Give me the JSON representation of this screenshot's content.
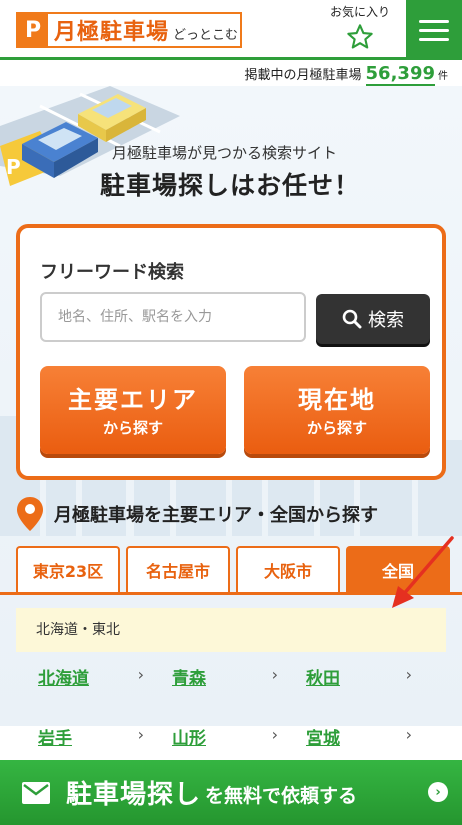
{
  "header": {
    "logo_mark": "P",
    "logo_main": "月極駐車場",
    "logo_sub": "どっとこむ",
    "favorites_label": "お気に入り"
  },
  "listing": {
    "label": "掲載中の月極駐車場",
    "count": "56,399",
    "unit": "件"
  },
  "hero": {
    "tagline": "月極駐車場が見つかる検索サイト",
    "headline": "駐車場探しはお任せ！"
  },
  "search": {
    "title": "フリーワード検索",
    "placeholder": "地名、住所、駅名を入力",
    "button_label": "検索"
  },
  "quick_buttons": {
    "area_main": "主要エリア",
    "area_sub": "から探す",
    "location_main": "現在地",
    "location_sub": "から探す"
  },
  "section": {
    "title": "月極駐車場を主要エリア・全国から探す"
  },
  "tabs": [
    {
      "label": "東京23区",
      "active": false
    },
    {
      "label": "名古屋市",
      "active": false
    },
    {
      "label": "大阪市",
      "active": false
    },
    {
      "label": "全国",
      "active": true
    }
  ],
  "region": {
    "heading": "北海道・東北",
    "prefectures": [
      "北海道",
      "青森",
      "秋田",
      "岩手",
      "山形",
      "宮城"
    ]
  },
  "cta": {
    "main": "駐車場探し",
    "sub": "を無料で依頼する"
  },
  "colors": {
    "brand_green": "#2e9e3a",
    "brand_orange": "#ec6c18",
    "annotation_red": "#e53020"
  },
  "icons": {
    "favorites": "star-outline-icon",
    "menu": "hamburger-menu-icon",
    "search": "magnifier-icon",
    "location": "map-pin-icon",
    "mail": "envelope-icon",
    "chevron": "chevron-right-icon"
  }
}
